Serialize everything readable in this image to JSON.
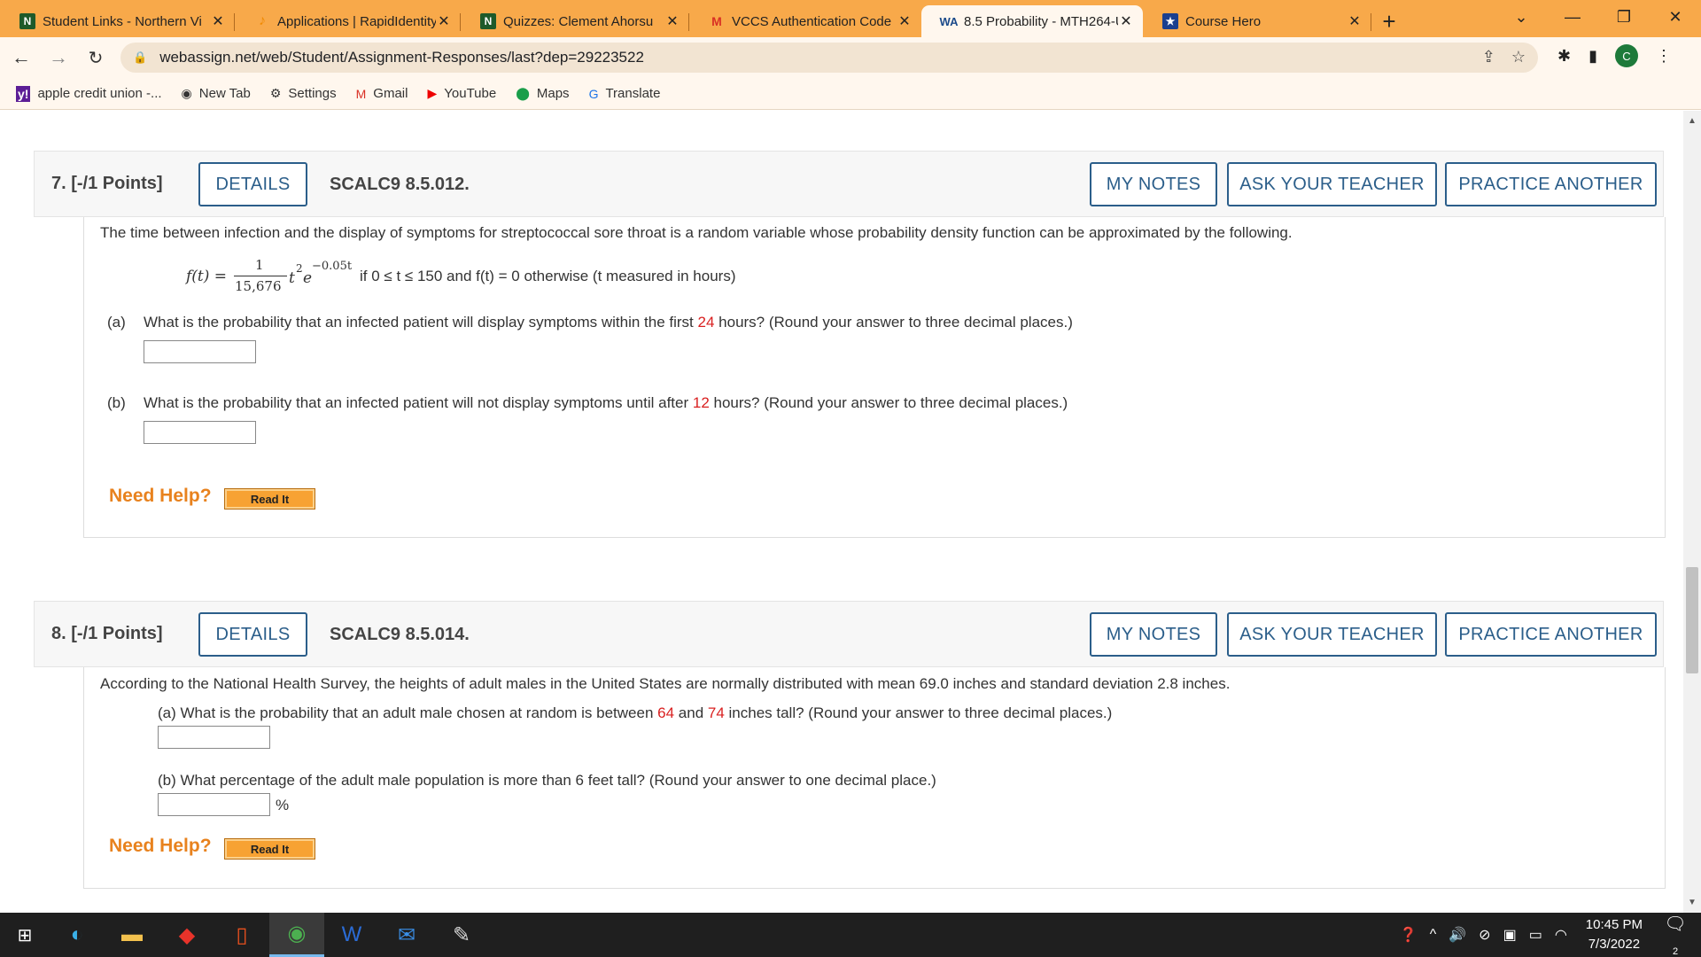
{
  "browser": {
    "tabs": [
      {
        "icon": "N",
        "title": "Student Links - Northern Vi"
      },
      {
        "icon": "♪",
        "title": "Applications | RapidIdentity"
      },
      {
        "icon": "N",
        "title": "Quizzes: Clement Ahorsu"
      },
      {
        "icon": "M",
        "title": "VCCS Authentication Code"
      },
      {
        "icon": "WA",
        "title": "8.5 Probability - MTH264-U"
      },
      {
        "icon": "★",
        "title": "Course Hero"
      }
    ],
    "url": "webassign.net/web/Student/Assignment-Responses/last?dep=29223522",
    "profile_initial": "C",
    "bookmarks": [
      {
        "icon": "y!",
        "label": "apple credit union -..."
      },
      {
        "icon": "◉",
        "label": "New Tab"
      },
      {
        "icon": "⚙",
        "label": "Settings"
      },
      {
        "icon": "M",
        "label": "Gmail"
      },
      {
        "icon": "▶",
        "label": "YouTube"
      },
      {
        "icon": "⬤",
        "label": "Maps"
      },
      {
        "icon": "G",
        "label": "Translate"
      }
    ]
  },
  "buttons": {
    "details": "DETAILS",
    "my_notes": "MY NOTES",
    "ask_teacher": "ASK YOUR TEACHER",
    "practice": "PRACTICE ANOTHER",
    "read_it": "Read It",
    "need_help": "Need Help?"
  },
  "q7": {
    "number": "7. [-/1 Points]",
    "code": "SCALC9 8.5.012.",
    "intro": "The time between infection and the display of symptoms for streptococcal sore throat is a random variable whose probability density function can be approximated by the following.",
    "formula": {
      "lhs": "f(t) =",
      "numerator": "1",
      "denominator": "15,676",
      "t2": "t",
      "exp2": "2",
      "e": "e",
      "exponent": "−0.05t",
      "condition": "if 0 ≤ t ≤ 150 and f(t) = 0 otherwise (t measured in hours)"
    },
    "a": {
      "label": "(a)",
      "pre": "What is the probability that an infected patient will display symptoms within the first ",
      "val": "24",
      "post": " hours? (Round your answer to three decimal places.)"
    },
    "b": {
      "label": "(b)",
      "pre": "What is the probability that an infected patient will not display symptoms until after ",
      "val": "12",
      "post": " hours? (Round your answer to three decimal places.)"
    }
  },
  "q8": {
    "number": "8. [-/1 Points]",
    "code": "SCALC9 8.5.014.",
    "intro": "According to the National Health Survey, the heights of adult males in the United States are normally distributed with mean 69.0 inches and standard deviation 2.8 inches.",
    "a": {
      "pre": "(a) What is the probability that an adult male chosen at random is between ",
      "v1": "64",
      "mid": " and ",
      "v2": "74",
      "post": " inches tall? (Round your answer to three decimal places.)"
    },
    "b": {
      "text": "(b) What percentage of the adult male population is more than 6 feet tall? (Round your answer to one decimal place.)",
      "unit": "%"
    }
  },
  "taskbar": {
    "time": "10:45 PM",
    "date": "7/3/2022",
    "notifications": "2"
  }
}
